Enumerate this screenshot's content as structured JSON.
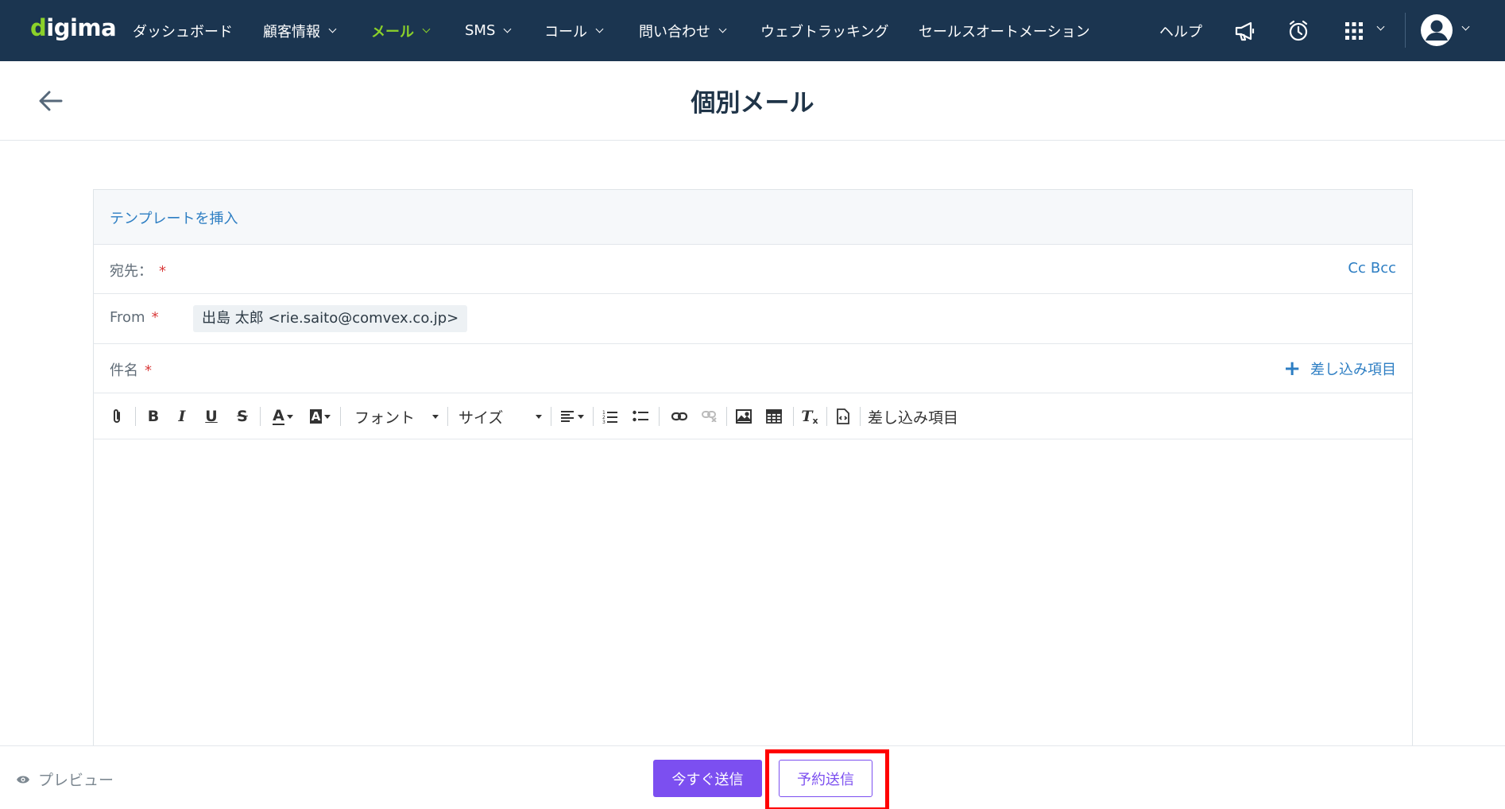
{
  "brand": {
    "name": "digima",
    "accent": "#8bd12a",
    "nav_bg": "#1b3550"
  },
  "nav": {
    "items": [
      {
        "label": "ダッシュボード",
        "has_dropdown": false,
        "active": false
      },
      {
        "label": "顧客情報",
        "has_dropdown": true,
        "active": false
      },
      {
        "label": "メール",
        "has_dropdown": true,
        "active": true
      },
      {
        "label": "SMS",
        "has_dropdown": true,
        "active": false
      },
      {
        "label": "コール",
        "has_dropdown": true,
        "active": false
      },
      {
        "label": "問い合わせ",
        "has_dropdown": true,
        "active": false
      },
      {
        "label": "ウェブトラッキング",
        "has_dropdown": false,
        "active": false
      },
      {
        "label": "セールスオートメーション",
        "has_dropdown": false,
        "active": false
      }
    ],
    "help_label": "ヘルプ",
    "icons": [
      "megaphone-icon",
      "alarm-clock-icon",
      "apps-grid-icon",
      "user-avatar-icon"
    ]
  },
  "page": {
    "title": "個別メール"
  },
  "composer": {
    "template_link": "テンプレートを挿入",
    "to_label": "宛先：",
    "required_mark": "*",
    "cc": "Cc",
    "bcc": "Bcc",
    "from_label": "From",
    "from_value": "出島 太郎 <rie.saito@comvex.co.jp>",
    "subject_label": "件名",
    "insert_field_label": "差し込み項目",
    "toolbar": {
      "font_label": "フォント",
      "size_label": "サイズ",
      "insert_field_label": "差し込み項目"
    }
  },
  "footer": {
    "preview_label": "プレビュー",
    "send_now_label": "今すぐ送信",
    "schedule_label": "予約送信",
    "primary_color": "#7c4ff0",
    "highlight_color": "#ff0000"
  }
}
